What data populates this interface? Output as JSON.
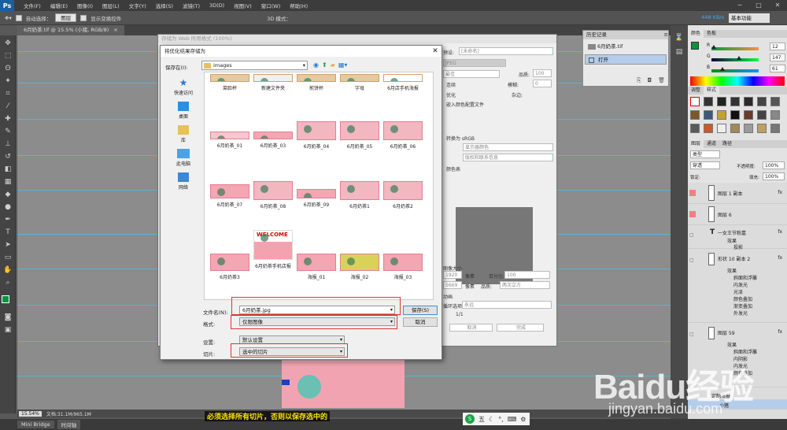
{
  "app": {
    "logo": "Ps",
    "menu": [
      "文件(F)",
      "编辑(E)",
      "图像(I)",
      "图层(L)",
      "文字(Y)",
      "选择(S)",
      "滤镜(T)",
      "3D(D)",
      "视图(V)",
      "窗口(W)",
      "帮助(H)"
    ],
    "window_controls": [
      "─",
      "□",
      "✕"
    ]
  },
  "options": {
    "auto_select_label": "自动选择：",
    "auto_select_value": "图层",
    "show_transform_label": "显示变换控件",
    "mode3d_label": "3D 模式：",
    "speed": "448 KB/s",
    "workspace": "基本功能"
  },
  "doc_tab": {
    "title": "6月奶茶.tif @ 15.5% (小猪, RGB/8)",
    "close": "×"
  },
  "status": {
    "zoom": "15.54%",
    "doc": "文档:31.1M/965.1M"
  },
  "bottom_tabs": [
    "Mini Bridge",
    "时间轴"
  ],
  "subtitle": "必须选择所有切片，否则以保存选中的",
  "ime": {
    "label": "五"
  },
  "sfw": {
    "title": "存储为 Web 所用格式 (100%)",
    "preset_label": "预设:",
    "preset_value": "[未命名]",
    "format": "JPEG",
    "quality_mode": "最佳",
    "quality_label": "品质:",
    "quality_value": "100",
    "progressive": "连续",
    "blur_label": "模糊:",
    "blur_value": "0",
    "optimize": "优化",
    "matte_label": "杂边:",
    "embed_profile": "嵌入颜色配置文件",
    "convert_srgb": "转换为 sRGB",
    "preview_label": "预览:",
    "preview_value": "显示器颜色",
    "metadata_label": "元数据:",
    "metadata_value": "版权和联系信息",
    "color_table": "颜色表",
    "image_size": "图像大小",
    "w_label": "W:",
    "w_value": "1920",
    "h_label": "H:",
    "h_value": "5669",
    "unit": "像素",
    "percent_label": "百分比:",
    "percent_value": "100",
    "pct_sign": "%",
    "quality2_label": "品质:",
    "quality2_value": "两次立方",
    "animation": "动画",
    "loop_label": "循环选项:",
    "loop_value": "永远",
    "frame": "1/1",
    "cancel": "取消",
    "done": "完成"
  },
  "save_dialog": {
    "title": "将优化结果存储为",
    "close": "✕",
    "save_in_label": "保存在(I):",
    "save_in_value": "images",
    "places": [
      "快速访问",
      "桌面",
      "库",
      "此电脑",
      "网络"
    ],
    "files": [
      {
        "name": "菜脸杯"
      },
      {
        "name": "新建文件夹"
      },
      {
        "name": "煎饼杯"
      },
      {
        "name": "字母"
      },
      {
        "name": "6月店手机海报"
      },
      {
        "name": "6月奶茶_01"
      },
      {
        "name": "6月奶茶_03"
      },
      {
        "name": "6月奶茶_04"
      },
      {
        "name": "6月奶茶_05"
      },
      {
        "name": "6月奶茶_06"
      },
      {
        "name": "6月奶茶_07"
      },
      {
        "name": "6月奶茶_08"
      },
      {
        "name": "6月奶茶_09"
      },
      {
        "name": "6月奶茶1"
      },
      {
        "name": "6月奶茶2"
      },
      {
        "name": "6月奶茶3"
      },
      {
        "name": "6月奶茶手机店报",
        "welcome": "WELCOME"
      },
      {
        "name": "海报_01"
      },
      {
        "name": "海报_02"
      },
      {
        "name": "海报_03"
      }
    ],
    "filename_label": "文件名(N):",
    "filename_value": "6月奶茶.jpg",
    "format_label": "格式:",
    "format_value": "仅限图像",
    "settings_label": "设置:",
    "settings_value": "默认设置",
    "slices_label": "切片:",
    "slices_value": "选中的切片",
    "save_button": "保存(S)",
    "cancel_button": "取消"
  },
  "history": {
    "title": "历史记录",
    "snapshot": "6月奶茶.tif",
    "item": "打开"
  },
  "color_panel": {
    "tabs": [
      "颜色",
      "色板"
    ],
    "r_label": "R",
    "r_value": "12",
    "g_label": "G",
    "g_value": "147",
    "b_label": "B",
    "b_value": "61",
    "r_level": 0.05,
    "g_level": 0.58,
    "b_level": 0.24,
    "fg_color": "#0c933d"
  },
  "styles_panel": {
    "tabs": [
      "调整",
      "样式"
    ]
  },
  "layers_panel": {
    "tabs": [
      "图层",
      "通道",
      "路径"
    ],
    "kind_value": "类型",
    "blend_value": "穿透",
    "opacity_label": "不透明度:",
    "opacity_value": "100%",
    "lock_label": "锁定:",
    "fill_label": "填充:",
    "fill_value": "100%",
    "layers": [
      {
        "name": "图层 1 副本",
        "fx": "fx"
      },
      {
        "name": "图层 6",
        "fx": ""
      },
      {
        "name": "一女王节粉嘉",
        "fx": "fx"
      },
      {
        "name": "形状 10 副本 2",
        "fx": "fx"
      },
      {
        "name": "图层 59",
        "fx": "fx"
      }
    ],
    "effects": {
      "e1": [
        "效果",
        "投影"
      ],
      "e2": [
        "效果",
        "斜面和浮雕",
        "内发光",
        "光泽",
        "颜色叠加",
        "渐变叠加",
        "外发光"
      ],
      "e3": [
        "效果",
        "斜面和浮雕",
        "内阴影",
        "内发光",
        "颜色叠加"
      ]
    },
    "group1": "定制海报",
    "group2": "小猪",
    "text_layer_icon": "T"
  },
  "watermark": {
    "brand": "Baidu经验",
    "url": "jingyan.baidu.com"
  }
}
